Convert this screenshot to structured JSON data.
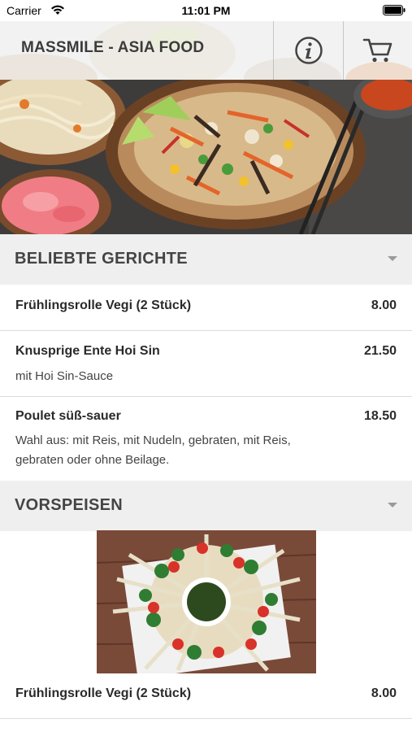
{
  "status_bar": {
    "carrier": "Carrier",
    "time": "11:01 PM"
  },
  "header": {
    "title": "MASSMILE - ASIA FOOD",
    "info_icon": "info-icon",
    "cart_icon": "cart-icon"
  },
  "sections": [
    {
      "title": "BELIEBTE GERICHTE",
      "items": [
        {
          "name": "Frühlingsrolle Vegi (2 Stück)",
          "price": "8.00",
          "description": ""
        },
        {
          "name": "Knusprige Ente Hoi Sin",
          "price": "21.50",
          "description": "mit Hoi Sin-Sauce"
        },
        {
          "name": "Poulet süß-sauer",
          "price": "18.50",
          "description_lines": [
            "Wahl aus: mit Reis, mit Nudeln, gebraten, mit Reis,",
            "gebraten oder ohne Beilage."
          ]
        }
      ]
    },
    {
      "title": "VORSPEISEN",
      "items": [
        {
          "name": "Frühlingsrolle Vegi (2 Stück)",
          "price": "8.00"
        }
      ]
    }
  ],
  "colors": {
    "section_bg": "#efefef",
    "text": "#2a2a2a",
    "divider": "#dcdcdc"
  }
}
